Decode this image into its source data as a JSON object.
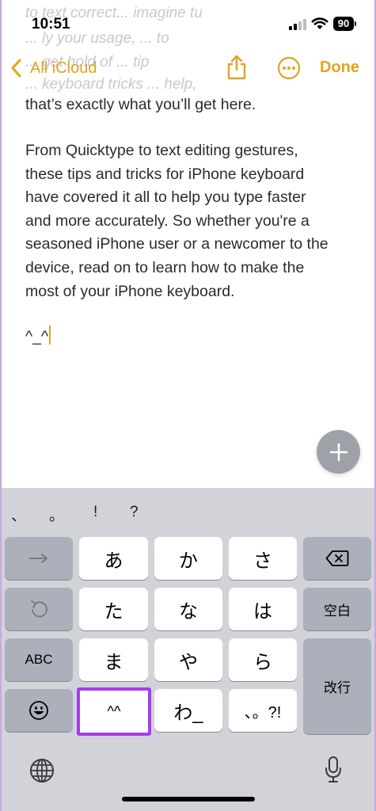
{
  "status_bar": {
    "time": "10:51",
    "battery": "90"
  },
  "note": {
    "faded_lines": [
      "to text correct... imagine tu",
      "... ly your usage, ... to",
      "... get hold of ... tip",
      "... keyboard tricks ... help,"
    ],
    "paragraph1_end": "that’s exactly what you’ll get here.",
    "paragraph2_lines": [
      "From Quicktype to text editing gestures,",
      "these tips and tricks for iPhone keyboard",
      "have covered it all to help you type faster",
      "and more accurately. So whether you're a",
      "seasoned iPhone user or a newcomer to the",
      "device, read on to learn how to make the",
      "most of your iPhone keyboard."
    ],
    "typed": "^_^"
  },
  "nav": {
    "back_label": "All iCloud",
    "done_label": "Done",
    "accent": "#e2a320"
  },
  "keyboard": {
    "candidates": [
      "、",
      "。",
      "!",
      "?"
    ],
    "row1": [
      "あ",
      "か",
      "さ"
    ],
    "row2": [
      "た",
      "な",
      "は"
    ],
    "row3": [
      "ま",
      "や",
      "ら"
    ],
    "row4": [
      "^^",
      "わ_",
      "、。?!"
    ],
    "abc_label": "ABC",
    "space_label": "空白",
    "enter_label": "改行",
    "highlight_color": "#a43cf0"
  }
}
